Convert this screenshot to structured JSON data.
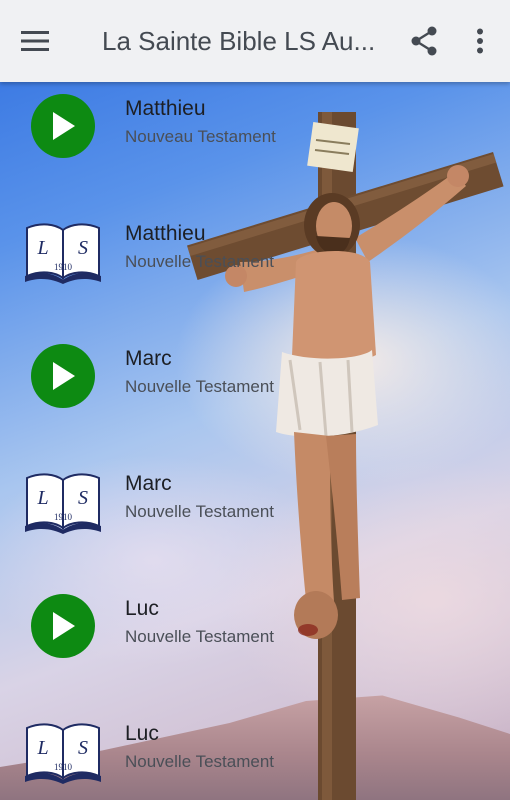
{
  "app_bar": {
    "title": "La Sainte Bible LS Au...",
    "menu_icon": "hamburger-menu-icon",
    "share_icon": "share-icon",
    "overflow_icon": "more-vert-icon"
  },
  "items": [
    {
      "title": "Matthieu",
      "subtitle": "Nouveau Testament",
      "icon": "play-icon"
    },
    {
      "title": "Matthieu",
      "subtitle": "Nouvelle Testament",
      "icon": "bible-ls1910-icon"
    },
    {
      "title": "Marc",
      "subtitle": "Nouvelle Testament",
      "icon": "play-icon"
    },
    {
      "title": "Marc",
      "subtitle": "Nouvelle Testament",
      "icon": "bible-ls1910-icon"
    },
    {
      "title": "Luc",
      "subtitle": "Nouvelle Testament",
      "icon": "play-icon"
    },
    {
      "title": "Luc",
      "subtitle": "Nouvelle Testament",
      "icon": "bible-ls1910-icon"
    }
  ],
  "bible_icon": {
    "letters_left": "L",
    "letters_right": "S",
    "year": "1910"
  },
  "colors": {
    "app_bar": "#f0f1f3",
    "play_button": "#0d8a12",
    "title_text": "#444a52"
  }
}
